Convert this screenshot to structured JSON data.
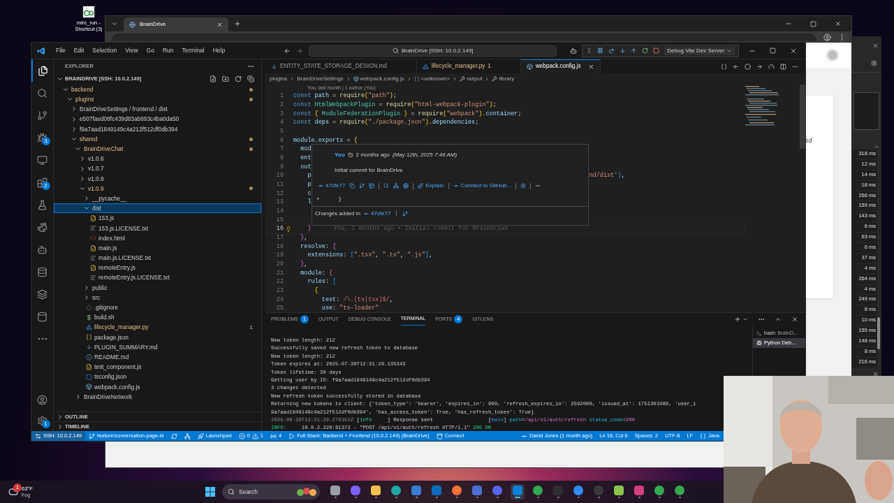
{
  "desktop_icon": {
    "label": "mirc_run - Shortcut (3)"
  },
  "browser": {
    "tab": {
      "title": "BrainDrive"
    },
    "page_fragment": "ed"
  },
  "devtools": {
    "timings": [
      "318 ms",
      "12 ms",
      "14 ms",
      "18 ms",
      "266 ms",
      "159 ms",
      "143 ms",
      "6 ms",
      "63 ms",
      "6 ms",
      "37 ms",
      "4 ms",
      "264 ms",
      "4 ms",
      "249 ms",
      "8 ms",
      "10 ms",
      "155 ms",
      "148 ms",
      "8 ms",
      "216 ms"
    ]
  },
  "vscode": {
    "menu": [
      "File",
      "Edit",
      "Selection",
      "View",
      "Go",
      "Run",
      "Terminal",
      "Help"
    ],
    "command_center": "BrainDrive [SSH: 10.0.2.149]",
    "debug_config": "Debug Vite Dev Server",
    "activity_bar": [
      {
        "kind": "files",
        "selected": true
      },
      {
        "kind": "search",
        "selected": false
      },
      {
        "kind": "git",
        "selected": false
      },
      {
        "kind": "debug",
        "selected": false,
        "badge": "3"
      },
      {
        "kind": "remote",
        "selected": false
      },
      {
        "kind": "extensions",
        "selected": false,
        "badge": "2"
      },
      {
        "kind": "testing",
        "selected": false
      },
      {
        "kind": "rabbit",
        "selected": false
      },
      {
        "kind": "bot",
        "selected": false
      },
      {
        "kind": "database",
        "selected": false
      },
      {
        "kind": "layers",
        "selected": false
      },
      {
        "kind": "cylinder",
        "selected": false
      },
      {
        "kind": "more",
        "selected": false
      }
    ],
    "activity_bottom": [
      {
        "kind": "account"
      },
      {
        "kind": "settings",
        "badge": "1"
      }
    ],
    "explorer": {
      "title": "EXPLORER",
      "root": "BRAINDRIVE [SSH: 10.0.2.149]",
      "tree": [
        {
          "name": "backend",
          "kind": "folder",
          "expanded": true,
          "selected": false,
          "modified": true,
          "children": [
            {
              "name": "plugins",
              "kind": "folder",
              "expanded": true,
              "selected": false,
              "modified": true,
              "children": [
                {
                  "name": "BrainDriveSettings / frontend / dist",
                  "kind": "folder",
                  "expanded": false,
                  "selected": false,
                  "modified": false
                },
                {
                  "name": "e507faed08fc439d83ab693c4ba0da50",
                  "kind": "folder",
                  "expanded": false,
                  "selected": false,
                  "modified": false
                },
                {
                  "name": "f9a7aad1849149c4a212f512df0db394",
                  "kind": "folder",
                  "expanded": false,
                  "selected": false,
                  "modified": false
                },
                {
                  "name": "shared",
                  "kind": "folder",
                  "expanded": true,
                  "selected": false,
                  "modified": true,
                  "children": [
                    {
                      "name": "BrainDriveChat",
                      "kind": "folder",
                      "expanded": true,
                      "selected": false,
                      "modified": true,
                      "children": [
                        {
                          "name": "v1.0.6",
                          "kind": "folder",
                          "expanded": false,
                          "selected": false,
                          "modified": false
                        },
                        {
                          "name": "v1.0.7",
                          "kind": "folder",
                          "expanded": false,
                          "selected": false,
                          "modified": false
                        },
                        {
                          "name": "v1.0.8",
                          "kind": "folder",
                          "expanded": false,
                          "selected": false,
                          "modified": false
                        },
                        {
                          "name": "v1.0.9",
                          "kind": "folder",
                          "expanded": true,
                          "selected": false,
                          "modified": true,
                          "children": [
                            {
                              "name": "__pycache__",
                              "kind": "folder",
                              "expanded": false,
                              "selected": false,
                              "modified": false
                            },
                            {
                              "name": "dist",
                              "kind": "folder",
                              "expanded": true,
                              "selected": true,
                              "modified": false,
                              "children": [
                                {
                                  "name": "153.js",
                                  "kind": "js",
                                  "selected": false,
                                  "modified": false
                                },
                                {
                                  "name": "153.js.LICENSE.txt",
                                  "kind": "text",
                                  "selected": false,
                                  "modified": false
                                },
                                {
                                  "name": "index.html",
                                  "kind": "html",
                                  "selected": false,
                                  "modified": false
                                },
                                {
                                  "name": "main.js",
                                  "kind": "js",
                                  "selected": false,
                                  "modified": false
                                },
                                {
                                  "name": "main.js.LICENSE.txt",
                                  "kind": "text",
                                  "selected": false,
                                  "modified": false
                                },
                                {
                                  "name": "remoteEntry.js",
                                  "kind": "js",
                                  "selected": false,
                                  "modified": false
                                },
                                {
                                  "name": "remoteEntry.js.LICENSE.txt",
                                  "kind": "text",
                                  "selected": false,
                                  "modified": false
                                }
                              ]
                            },
                            {
                              "name": "public",
                              "kind": "folder",
                              "expanded": false,
                              "selected": false,
                              "modified": false
                            },
                            {
                              "name": "src",
                              "kind": "folder",
                              "expanded": false,
                              "selected": false,
                              "modified": false
                            },
                            {
                              "name": ".gitignore",
                              "kind": "git",
                              "selected": false,
                              "modified": false
                            },
                            {
                              "name": "build.sh",
                              "kind": "shell",
                              "selected": false,
                              "modified": false
                            },
                            {
                              "name": "lifecycle_manager.py",
                              "kind": "python",
                              "selected": false,
                              "modified": true,
                              "badge": "1"
                            },
                            {
                              "name": "package.json",
                              "kind": "json",
                              "selected": false,
                              "modified": false
                            },
                            {
                              "name": "PLUGIN_SUMMARY.md",
                              "kind": "markdown",
                              "selected": false,
                              "modified": false
                            },
                            {
                              "name": "README.md",
                              "kind": "readme",
                              "selected": false,
                              "modified": false
                            },
                            {
                              "name": "test_component.js",
                              "kind": "js",
                              "selected": false,
                              "modified": false
                            },
                            {
                              "name": "tsconfig.json",
                              "kind": "tsconfig",
                              "selected": false,
                              "modified": false
                            },
                            {
                              "name": "webpack.config.js",
                              "kind": "webpack",
                              "selected": false,
                              "modified": false
                            }
                          ]
                        }
                      ]
                    },
                    {
                      "name": "BrainDriveNetwork",
                      "kind": "folder",
                      "expanded": false,
                      "selected": false,
                      "modified": false
                    }
                  ]
                }
              ]
            }
          ]
        }
      ],
      "sections": [
        {
          "label": "OUTLINE",
          "expanded": false
        },
        {
          "label": "TIMELINE",
          "expanded": false
        }
      ]
    },
    "tabs": [
      {
        "label": "ENTITY_STATE_STORAGE_DESIGN.md",
        "kind": "markdown",
        "selected": false,
        "modified": false
      },
      {
        "label": "lifecycle_manager.py",
        "kind": "python",
        "selected": false,
        "modified": true,
        "badge": "1"
      },
      {
        "label": "webpack.config.js",
        "kind": "webpack",
        "selected": true,
        "modified": false
      }
    ],
    "breadcrumbs": [
      {
        "label": "plugins",
        "kind": "folder"
      },
      {
        "label": "BrainDriveSettings",
        "kind": "folder"
      },
      {
        "label": "webpack.config.js",
        "kind": "webpack"
      },
      {
        "label": "<unknown>",
        "kind": "symbol"
      },
      {
        "label": "output",
        "kind": "wrench"
      },
      {
        "label": "library",
        "kind": "wrench"
      }
    ],
    "code_lens": "You, last month | 1 author (You)",
    "code_lines": [
      {
        "number": "1",
        "current": false,
        "lightbulb": false,
        "tokens": [
          {
            "kind": "kw",
            "text": "const "
          },
          {
            "kind": "var",
            "text": "path"
          },
          {
            "kind": "punc",
            "text": " = "
          },
          {
            "kind": "fn",
            "text": "require"
          },
          {
            "kind": "br1",
            "text": "("
          },
          {
            "kind": "str",
            "text": "\"path\""
          },
          {
            "kind": "br1",
            "text": ")"
          },
          {
            "kind": "punc",
            "text": ";"
          }
        ]
      },
      {
        "number": "2",
        "current": false,
        "lightbulb": false,
        "tokens": [
          {
            "kind": "kw",
            "text": "const "
          },
          {
            "kind": "cls",
            "text": "HtmlWebpackPlugin"
          },
          {
            "kind": "punc",
            "text": " = "
          },
          {
            "kind": "fn",
            "text": "require"
          },
          {
            "kind": "br1",
            "text": "("
          },
          {
            "kind": "str",
            "text": "\"html-webpack-plugin\""
          },
          {
            "kind": "br1",
            "text": ")"
          },
          {
            "kind": "punc",
            "text": ";"
          }
        ]
      },
      {
        "number": "3",
        "current": false,
        "lightbulb": false,
        "tokens": [
          {
            "kind": "kw",
            "text": "const "
          },
          {
            "kind": "br1",
            "text": "{ "
          },
          {
            "kind": "cls",
            "text": "ModuleFederationPlugin"
          },
          {
            "kind": "br1",
            "text": " }"
          },
          {
            "kind": "punc",
            "text": " = "
          },
          {
            "kind": "fn",
            "text": "require"
          },
          {
            "kind": "br1",
            "text": "("
          },
          {
            "kind": "str",
            "text": "\"webpack\""
          },
          {
            "kind": "br1",
            "text": ")"
          },
          {
            "kind": "punc",
            "text": "."
          },
          {
            "kind": "var",
            "text": "container"
          },
          {
            "kind": "punc",
            "text": ";"
          }
        ]
      },
      {
        "number": "4",
        "current": false,
        "lightbulb": false,
        "tokens": [
          {
            "kind": "kw",
            "text": "const "
          },
          {
            "kind": "var",
            "text": "deps"
          },
          {
            "kind": "punc",
            "text": " = "
          },
          {
            "kind": "fn",
            "text": "require"
          },
          {
            "kind": "br1",
            "text": "("
          },
          {
            "kind": "str",
            "text": "\"./package.json\""
          },
          {
            "kind": "br1",
            "text": ")"
          },
          {
            "kind": "punc",
            "text": "."
          },
          {
            "kind": "var",
            "text": "dependencies"
          },
          {
            "kind": "punc",
            "text": ";"
          }
        ]
      },
      {
        "number": "5",
        "current": false,
        "lightbulb": false
      },
      {
        "number": "6",
        "current": false,
        "lightbulb": false,
        "tokens": [
          {
            "kind": "var",
            "text": "module"
          },
          {
            "kind": "punc",
            "text": "."
          },
          {
            "kind": "var",
            "text": "exports"
          },
          {
            "kind": "punc",
            "text": " = "
          },
          {
            "kind": "br1",
            "text": "{"
          }
        ]
      },
      {
        "number": "7",
        "current": false,
        "lightbulb": false,
        "tokens": [
          {
            "kind": "prop",
            "text": "  mod"
          }
        ]
      },
      {
        "number": "8",
        "current": false,
        "lightbulb": false,
        "tokens": [
          {
            "kind": "prop",
            "text": "  ent"
          }
        ]
      },
      {
        "number": "9",
        "current": false,
        "lightbulb": false,
        "tokens": [
          {
            "kind": "prop",
            "text": "  out"
          }
        ]
      },
      {
        "number": "10",
        "current": false,
        "lightbulb": false,
        "tokens": [
          {
            "kind": "prop",
            "text": "    p"
          }
        ],
        "tail": [
          {
            "kind": "str",
            "text": "nd/dist'"
          },
          {
            "kind": "br3",
            "text": ")"
          },
          {
            "kind": "punc",
            "text": ","
          }
        ]
      },
      {
        "number": "11",
        "current": false,
        "lightbulb": false,
        "tokens": [
          {
            "kind": "prop",
            "text": "    p"
          }
        ]
      },
      {
        "number": "12",
        "current": false,
        "lightbulb": false,
        "tokens": [
          {
            "kind": "prop",
            "text": "    c"
          }
        ]
      },
      {
        "number": "13",
        "current": false,
        "lightbulb": false,
        "tokens": [
          {
            "kind": "prop",
            "text": "    l"
          }
        ]
      },
      {
        "number": "14",
        "current": false,
        "lightbulb": false
      },
      {
        "number": "15",
        "current": false,
        "lightbulb": false
      },
      {
        "number": "16",
        "current": true,
        "lightbulb": true,
        "tokens": [
          {
            "kind": "br2",
            "text": "    }"
          }
        ],
        "blame": "You, 2 months ago • Initial commit for BrainDrive"
      },
      {
        "number": "17",
        "current": false,
        "lightbulb": false,
        "tokens": [
          {
            "kind": "br2",
            "text": "  }"
          },
          {
            "kind": "punc",
            "text": ","
          }
        ]
      },
      {
        "number": "18",
        "current": false,
        "lightbulb": false,
        "tokens": [
          {
            "kind": "prop",
            "text": "  resolve"
          },
          {
            "kind": "punc",
            "text": ": "
          },
          {
            "kind": "br2",
            "text": "{"
          }
        ]
      },
      {
        "number": "19",
        "current": false,
        "lightbulb": false,
        "tokens": [
          {
            "kind": "prop",
            "text": "    extensions"
          },
          {
            "kind": "punc",
            "text": ": "
          },
          {
            "kind": "br3",
            "text": "["
          },
          {
            "kind": "str",
            "text": "\".tsx\""
          },
          {
            "kind": "punc",
            "text": ", "
          },
          {
            "kind": "str",
            "text": "\".ts\""
          },
          {
            "kind": "punc",
            "text": ", "
          },
          {
            "kind": "str",
            "text": "\".js\""
          },
          {
            "kind": "br3",
            "text": "]"
          },
          {
            "kind": "punc",
            "text": ","
          }
        ]
      },
      {
        "number": "20",
        "current": false,
        "lightbulb": false,
        "tokens": [
          {
            "kind": "br2",
            "text": "  }"
          },
          {
            "kind": "punc",
            "text": ","
          }
        ]
      },
      {
        "number": "21",
        "current": false,
        "lightbulb": false,
        "tokens": [
          {
            "kind": "prop",
            "text": "  module"
          },
          {
            "kind": "punc",
            "text": ": "
          },
          {
            "kind": "br2",
            "text": "{"
          }
        ]
      },
      {
        "number": "22",
        "current": false,
        "lightbulb": false,
        "tokens": [
          {
            "kind": "prop",
            "text": "    rules"
          },
          {
            "kind": "punc",
            "text": ": "
          },
          {
            "kind": "br3",
            "text": "["
          }
        ]
      },
      {
        "number": "23",
        "current": false,
        "lightbulb": false,
        "tokens": [
          {
            "kind": "br1",
            "text": "      {"
          }
        ]
      },
      {
        "number": "24",
        "current": false,
        "lightbulb": false,
        "tokens": [
          {
            "kind": "prop",
            "text": "        test"
          },
          {
            "kind": "punc",
            "text": ": "
          },
          {
            "kind": "regex",
            "text": "/\\.(ts|tsx)$/"
          },
          {
            "kind": "punc",
            "text": ","
          }
        ]
      },
      {
        "number": "25",
        "current": false,
        "lightbulb": false,
        "tokens": [
          {
            "kind": "prop",
            "text": "        use"
          },
          {
            "kind": "punc",
            "text": ": "
          },
          {
            "kind": "str",
            "text": "\"ts-loader\""
          }
        ]
      }
    ],
    "blame_hover": {
      "author": "You",
      "relative_time": "2 months ago",
      "date": "(May 12th, 2025 7:46 AM)",
      "message": "Initial commit for BrainDrive",
      "commit": "47cfe77",
      "actions": [
        {
          "kind": "explain",
          "label": "Explain"
        },
        {
          "kind": "github",
          "label": "Connect to GitHub..."
        }
      ],
      "diff_line": "+      }",
      "changes_label": "Changes added in",
      "changes_commit": "47cfe77"
    },
    "panel": {
      "tabs": [
        {
          "label": "PROBLEMS",
          "selected": false,
          "badge": "1"
        },
        {
          "label": "OUTPUT",
          "selected": false
        },
        {
          "label": "DEBUG CONSOLE",
          "selected": false
        },
        {
          "label": "TERMINAL",
          "selected": true
        },
        {
          "label": "PORTS",
          "selected": false,
          "badge": "4"
        },
        {
          "label": "GITLENS",
          "selected": false
        }
      ],
      "terminal_lines": [
        [
          {
            "kind": "plain",
            "text": "New token length: 212"
          }
        ],
        [
          {
            "kind": "plain",
            "text": "Successfully saved new refresh token to database"
          }
        ],
        [
          {
            "kind": "plain",
            "text": "New token length: 212"
          }
        ],
        [
          {
            "kind": "plain",
            "text": "Token expires at: 2025-07-30T12:31:29.135343"
          }
        ],
        [
          {
            "kind": "plain",
            "text": "Token lifetime: 30 days"
          }
        ],
        [
          {
            "kind": "plain",
            "text": "Getting user by ID: f9a7aad1849149c4a212f512df0db394"
          }
        ],
        [
          {
            "kind": "plain",
            "text": "3 changes detected"
          }
        ],
        [
          {
            "kind": "plain",
            "text": "New refresh token successfully stored in database"
          }
        ],
        [
          {
            "kind": "plain",
            "text": "Returning new tokens to client: {'token_type': 'bearer', 'expires_in': 900, 'refresh_expires_in': 2592000, 'issued_at': 1751301089, 'user_i"
          }
        ],
        [
          {
            "kind": "plain",
            "text": "9a7aad1849149c4a212f512df0db394', 'has_access_token': True, 'has_refresh_token': True}"
          }
        ],
        [
          {
            "kind": "dim",
            "text": "2025-06-30T12:31:29.279352Z"
          },
          {
            "kind": "plain",
            "text": " ["
          },
          {
            "kind": "green",
            "text": "info     "
          },
          {
            "kind": "plain",
            "text": "] Response sent                  ["
          },
          {
            "kind": "blue",
            "text": "main"
          },
          {
            "kind": "plain",
            "text": "] "
          },
          {
            "kind": "cyan",
            "text": "path"
          },
          {
            "kind": "plain",
            "text": "="
          },
          {
            "kind": "magenta",
            "text": "/api/v1/auth/refresh"
          },
          {
            "kind": "cyan",
            "text": " status_code"
          },
          {
            "kind": "plain",
            "text": "="
          },
          {
            "kind": "magenta",
            "text": "200"
          }
        ],
        [
          {
            "kind": "green",
            "text": "INFO:"
          },
          {
            "kind": "plain",
            "text": "     10.0.2.220:61372 - \"POST /api/v1/auth/refresh HTTP/1.1\" "
          },
          {
            "kind": "green",
            "text": "200 OK"
          }
        ]
      ],
      "terminals": [
        {
          "kind": "bash",
          "label": "bash",
          "detail": "BrainD...",
          "selected": false
        },
        {
          "kind": "debug",
          "label": "Python Deb...",
          "selected": true
        }
      ]
    },
    "status_bar": {
      "left": [
        {
          "kind": "remote",
          "label": "SSH: 10.0.2.149"
        },
        {
          "kind": "branch",
          "label": "feature/conversation-page-id"
        },
        {
          "kind": "sync"
        },
        {
          "kind": "graph"
        },
        {
          "kind": "launchpad",
          "label": "Launchpad"
        },
        {
          "kind": "problems",
          "errors": "0",
          "warnings": "1"
        },
        {
          "kind": "ports",
          "label": "4"
        },
        {
          "kind": "debug",
          "label": "Full Stack: Backend + Frontend (10.0.2.149) (BrainDrive)"
        },
        {
          "kind": "database",
          "label": "Connect"
        }
      ],
      "right": [
        {
          "kind": "blame",
          "label": "David Jones (1 month ago)"
        },
        {
          "kind": "text",
          "label": "Ln 16, Col 6"
        },
        {
          "kind": "text",
          "label": "Spaces: 2"
        },
        {
          "kind": "text",
          "label": "UTF-8"
        },
        {
          "kind": "text",
          "label": "LF"
        },
        {
          "kind": "language",
          "label": "Java"
        }
      ]
    }
  },
  "taskbar": {
    "weather": {
      "temperature": "63°F",
      "condition": "Fog",
      "badge": "1"
    },
    "search": {
      "label": "Search"
    },
    "apps": [
      {
        "kind": "taskview",
        "active": false
      },
      {
        "kind": "copilot",
        "active": false
      },
      {
        "kind": "folder",
        "active": false
      },
      {
        "kind": "edge",
        "active": false
      },
      {
        "kind": "store",
        "active": false
      },
      {
        "kind": "mail",
        "active": false
      },
      {
        "kind": "firefox",
        "active": false
      },
      {
        "kind": "disk",
        "active": false
      },
      {
        "kind": "discord",
        "active": false
      },
      {
        "kind": "vscode",
        "active": true
      },
      {
        "kind": "chrome",
        "active": false
      },
      {
        "kind": "terminal",
        "active": false
      },
      {
        "kind": "zoom",
        "active": false
      },
      {
        "kind": "obs",
        "active": false
      },
      {
        "kind": "notepad",
        "active": false
      },
      {
        "kind": "snip",
        "active": false
      },
      {
        "kind": "chrome",
        "active": false
      },
      {
        "kind": "chrome",
        "active": false
      }
    ]
  }
}
